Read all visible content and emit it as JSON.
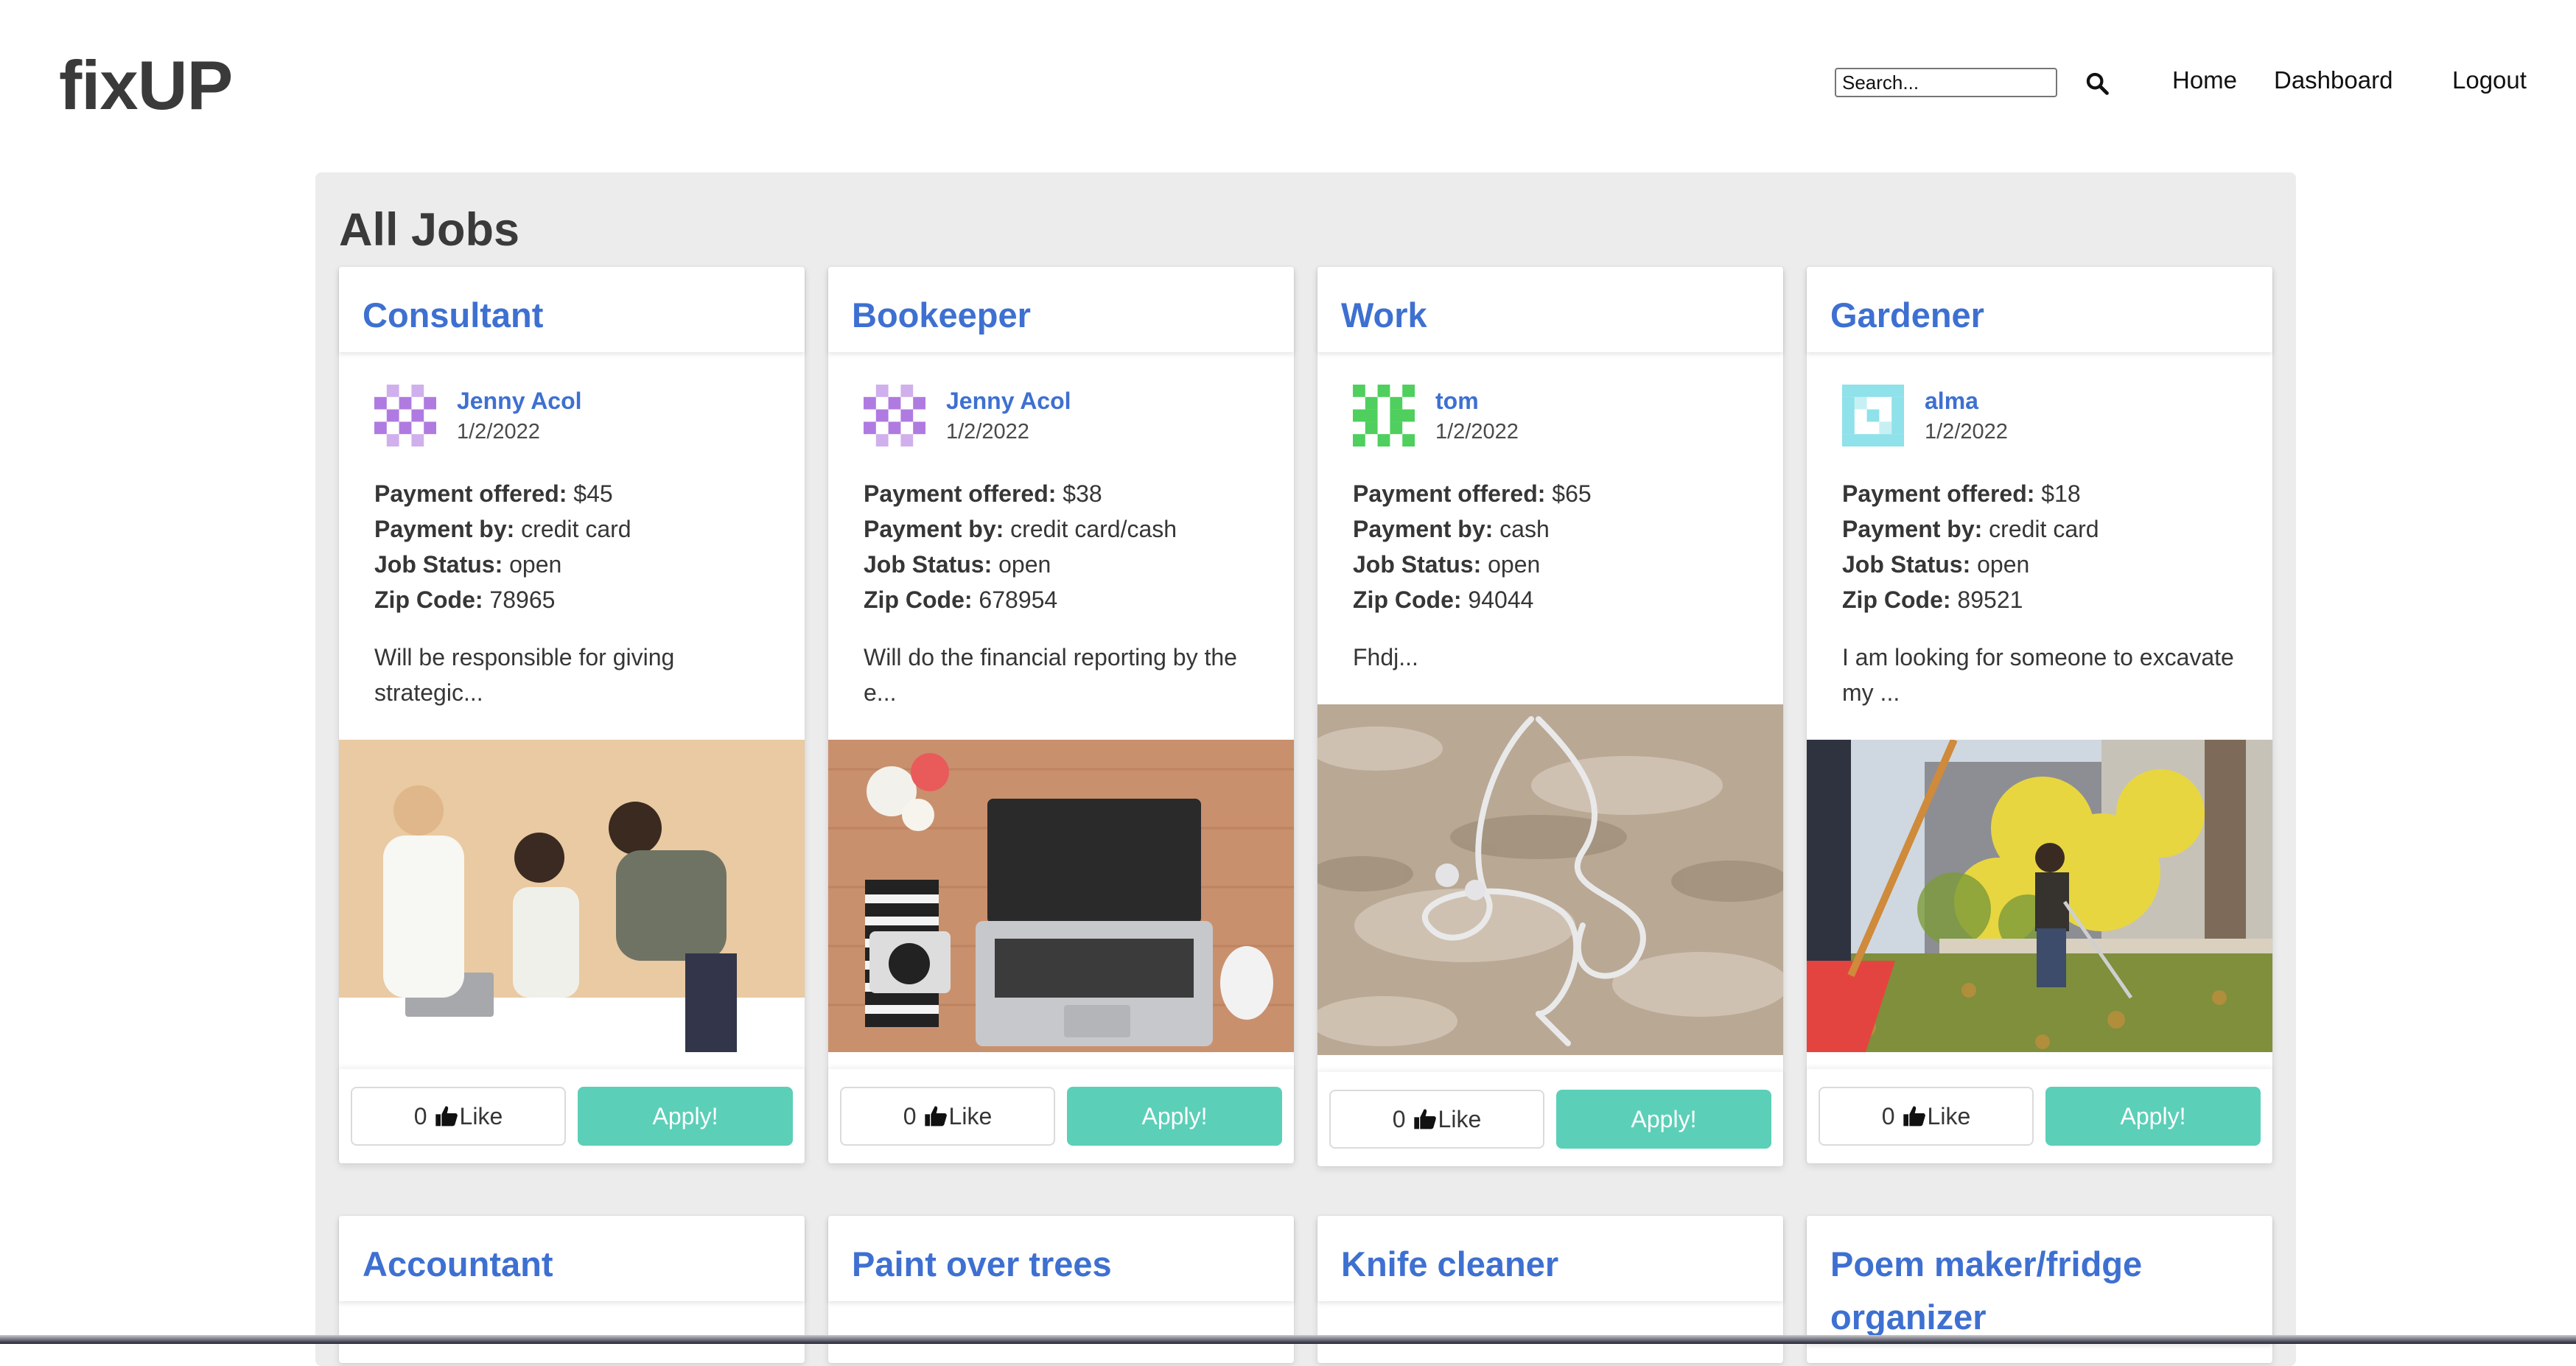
{
  "brand": {
    "logo": "fixUP"
  },
  "header": {
    "search_placeholder": "Search...",
    "nav": {
      "home": "Home",
      "dashboard": "Dashboard",
      "logout": "Logout"
    }
  },
  "page_title": "All Jobs",
  "jobs": [
    {
      "title": "Consultant",
      "author": "Jenny Acol",
      "date": "1/2/2022",
      "payment_offered_label": "Payment offered:",
      "payment_offered": "$45",
      "payment_by_label": "Payment by:",
      "payment_by": "credit card",
      "status_label": "Job Status:",
      "status": "open",
      "zip_label": "Zip Code:",
      "zip": "78965",
      "description": "Will be responsible for giving strategic...",
      "likes": "0",
      "like_label": "Like",
      "apply_label": "Apply!"
    },
    {
      "title": "Bookeeper",
      "author": "Jenny Acol",
      "date": "1/2/2022",
      "payment_offered_label": "Payment offered:",
      "payment_offered": "$38",
      "payment_by_label": "Payment by:",
      "payment_by": "credit card/cash",
      "status_label": "Job Status:",
      "status": "open",
      "zip_label": "Zip Code:",
      "zip": "678954",
      "description": "Will do the financial reporting by the e...",
      "likes": "0",
      "like_label": "Like",
      "apply_label": "Apply!"
    },
    {
      "title": "Work",
      "author": "tom",
      "date": "1/2/2022",
      "payment_offered_label": "Payment offered:",
      "payment_offered": "$65",
      "payment_by_label": "Payment by:",
      "payment_by": "cash",
      "status_label": "Job Status:",
      "status": "open",
      "zip_label": "Zip Code:",
      "zip": "94044",
      "description": "Fhdj...",
      "likes": "0",
      "like_label": "Like",
      "apply_label": "Apply!"
    },
    {
      "title": "Gardener",
      "author": "alma",
      "date": "1/2/2022",
      "payment_offered_label": "Payment offered:",
      "payment_offered": "$18",
      "payment_by_label": "Payment by:",
      "payment_by": "credit card",
      "status_label": "Job Status:",
      "status": "open",
      "zip_label": "Zip Code:",
      "zip": "89521",
      "description": "I am looking for someone to excavate my ...",
      "likes": "0",
      "like_label": "Like",
      "apply_label": "Apply!"
    }
  ],
  "jobs_row2": [
    {
      "title": "Accountant"
    },
    {
      "title": "Paint over trees"
    },
    {
      "title": "Knife cleaner"
    },
    {
      "title": "Poem maker/fridge organizer"
    }
  ],
  "colors": {
    "title_blue": "#3e70d1",
    "apply_teal": "#5ccfb8",
    "panel_gray": "#ececec"
  },
  "icons": {
    "search": "search-icon",
    "like": "thumbs-up-icon"
  }
}
